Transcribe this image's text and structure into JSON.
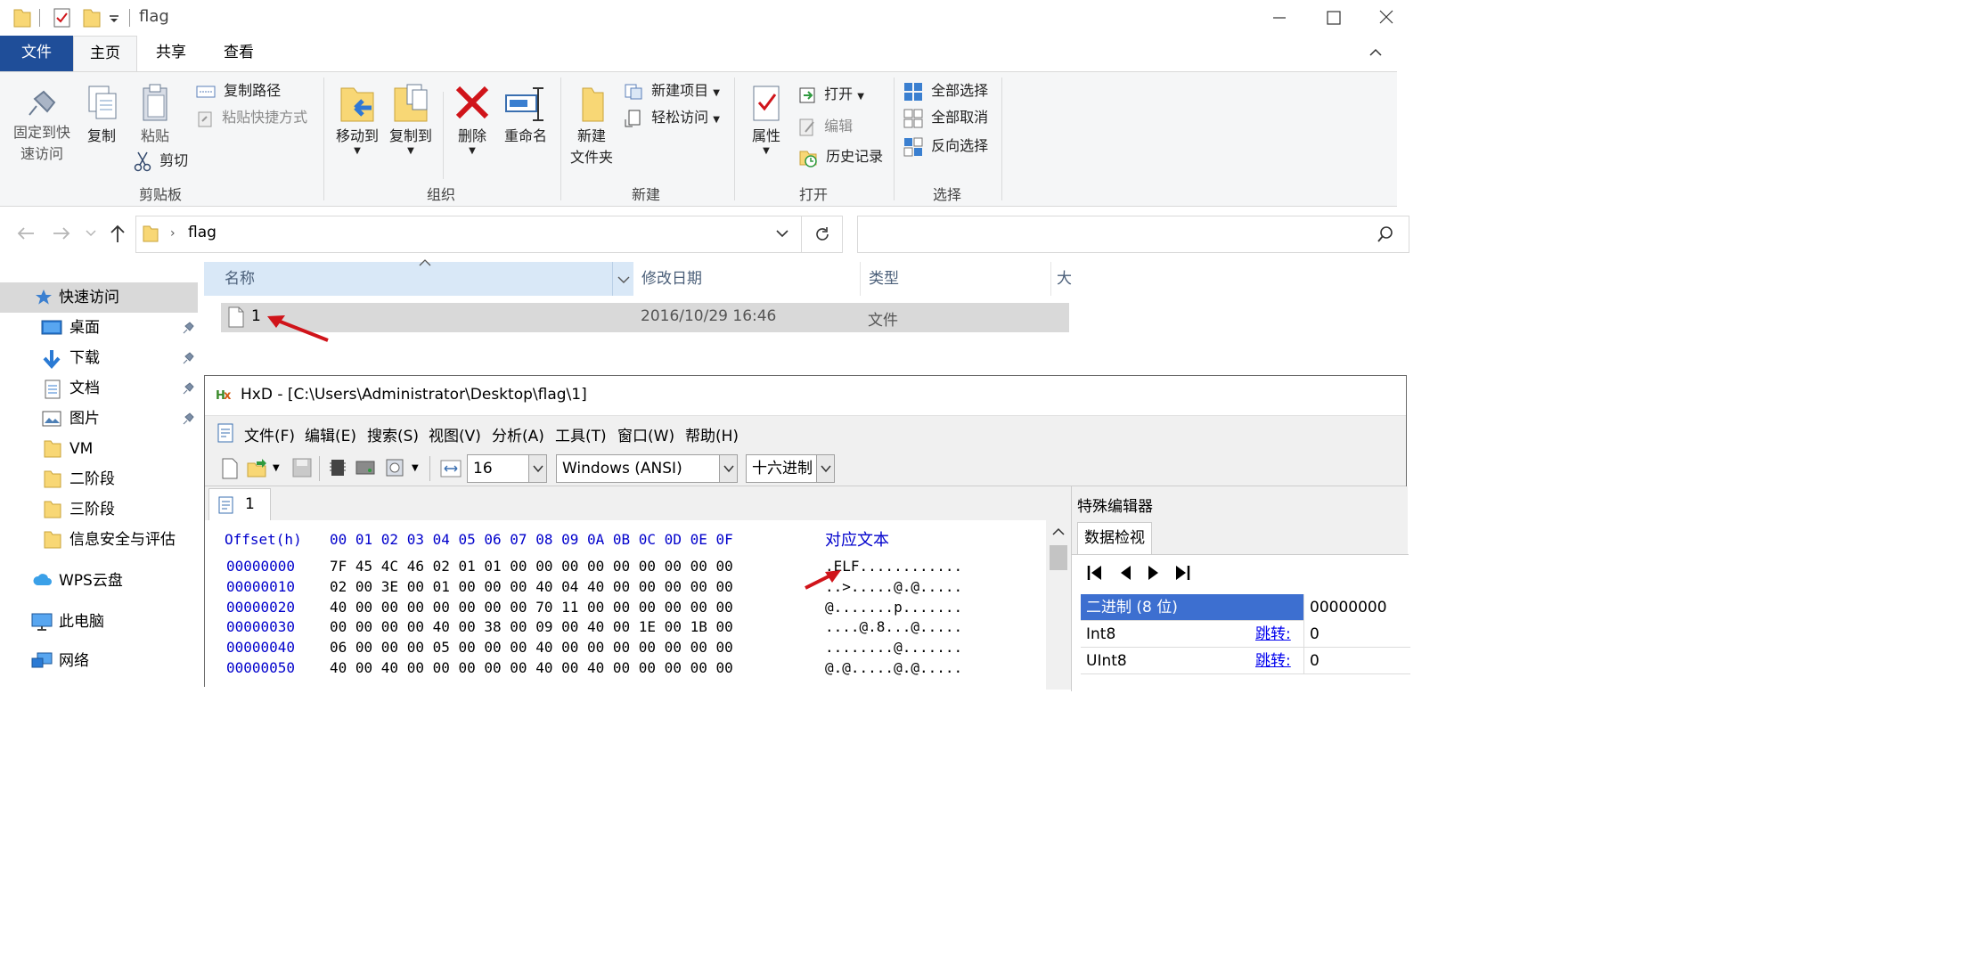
{
  "window": {
    "title": "flag",
    "buttons": {
      "minimize": "—",
      "maximize": "☐",
      "close": "✕"
    }
  },
  "ribbon_tabs": [
    "文件",
    "主页",
    "共享",
    "查看"
  ],
  "ribbon": {
    "clipboard": {
      "pin": "固定到快\n速访问",
      "copy": "复制",
      "paste": "粘贴",
      "copy_path": "复制路径",
      "paste_shortcut": "粘贴快捷方式",
      "cut": "剪切",
      "label": "剪贴板"
    },
    "organize": {
      "move_to": "移动到",
      "copy_to": "复制到",
      "delete": "删除",
      "rename": "重命名",
      "label": "组织"
    },
    "new": {
      "new_folder": "新建\n文件夹",
      "new_item": "新建项目",
      "easy_access": "轻松访问",
      "label": "新建"
    },
    "open": {
      "properties": "属性",
      "open": "打开",
      "edit": "编辑",
      "history": "历史记录",
      "label": "打开"
    },
    "select": {
      "select_all": "全部选择",
      "select_none": "全部取消",
      "invert": "反向选择",
      "label": "选择"
    }
  },
  "address": {
    "path": "flag",
    "search_placeholder": ""
  },
  "nav": {
    "quick_access": "快速访问",
    "items": [
      {
        "label": "桌面",
        "pinned": true
      },
      {
        "label": "下载",
        "pinned": true
      },
      {
        "label": "文档",
        "pinned": true
      },
      {
        "label": "图片",
        "pinned": true
      },
      {
        "label": "VM",
        "pinned": false
      },
      {
        "label": "二阶段",
        "pinned": false
      },
      {
        "label": "三阶段",
        "pinned": false
      },
      {
        "label": "信息安全与评估",
        "pinned": false
      }
    ],
    "wps": "WPS云盘",
    "this_pc": "此电脑",
    "network": "网络"
  },
  "columns": [
    "名称",
    "修改日期",
    "类型",
    "大"
  ],
  "files": [
    {
      "name": "1",
      "date": "2016/10/29 16:46",
      "type": "文件"
    }
  ],
  "hxd": {
    "title": "HxD - [C:\\Users\\Administrator\\Desktop\\flag\\1]",
    "menu": [
      "文件(F)",
      "编辑(E)",
      "搜索(S)",
      "视图(V)",
      "分析(A)",
      "工具(T)",
      "窗口(W)",
      "帮助(H)"
    ],
    "bytes_per_row": "16",
    "charset": "Windows (ANSI)",
    "base": "十六进制",
    "tab": "1",
    "header_offset": "Offset(h)",
    "header_cols": "00 01 02 03 04 05 06 07 08 09 0A 0B 0C 0D 0E 0F",
    "header_text": "对应文本",
    "rows": [
      {
        "offset": "00000000",
        "bytes": "7F 45 4C 46 02 01 01 00 00 00 00 00 00 00 00 00",
        "text": ".ELF............"
      },
      {
        "offset": "00000010",
        "bytes": "02 00 3E 00 01 00 00 00 40 04 40 00 00 00 00 00",
        "text": "..>.....@.@....."
      },
      {
        "offset": "00000020",
        "bytes": "40 00 00 00 00 00 00 00 70 11 00 00 00 00 00 00",
        "text": "@.......p......."
      },
      {
        "offset": "00000030",
        "bytes": "00 00 00 00 40 00 38 00 09 00 40 00 1E 00 1B 00",
        "text": "....@.8...@....."
      },
      {
        "offset": "00000040",
        "bytes": "06 00 00 00 05 00 00 00 40 00 00 00 00 00 00 00",
        "text": "........@......."
      },
      {
        "offset": "00000050",
        "bytes": "40 00 40 00 00 00 00 00 40 00 40 00 00 00 00 00",
        "text": "@.@.....@.@....."
      }
    ],
    "side": {
      "title": "特殊编辑器",
      "tab": "数据检视",
      "rows": [
        {
          "key": "二进制 (8 位)",
          "link": "",
          "value": "00000000"
        },
        {
          "key": "Int8",
          "link": "跳转:",
          "value": "0"
        },
        {
          "key": "UInt8",
          "link": "跳转:",
          "value": "0"
        }
      ]
    }
  },
  "colors": {
    "accent": "#1f4e99",
    "annotation_arrow": "#d0141a",
    "hex_blue": "#0000cc",
    "selection": "#3d6fd0"
  }
}
